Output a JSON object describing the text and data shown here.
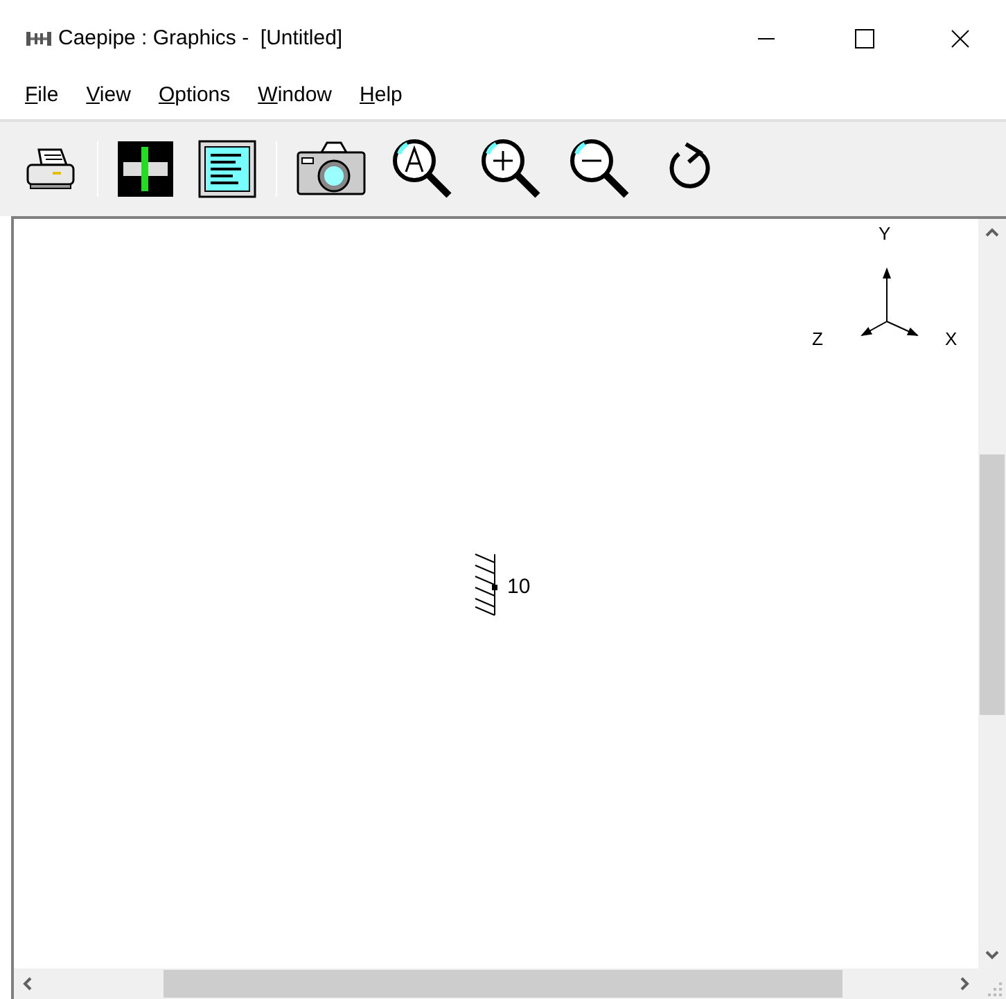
{
  "window": {
    "title": "Caepipe : Graphics -  [Untitled]"
  },
  "menu": [
    {
      "label": "File"
    },
    {
      "label": "View"
    },
    {
      "label": "Options"
    },
    {
      "label": "Window"
    },
    {
      "label": "Help"
    }
  ],
  "canvas": {
    "axes": {
      "y": "Y",
      "z": "Z",
      "x": "X"
    },
    "node_label": "10"
  }
}
